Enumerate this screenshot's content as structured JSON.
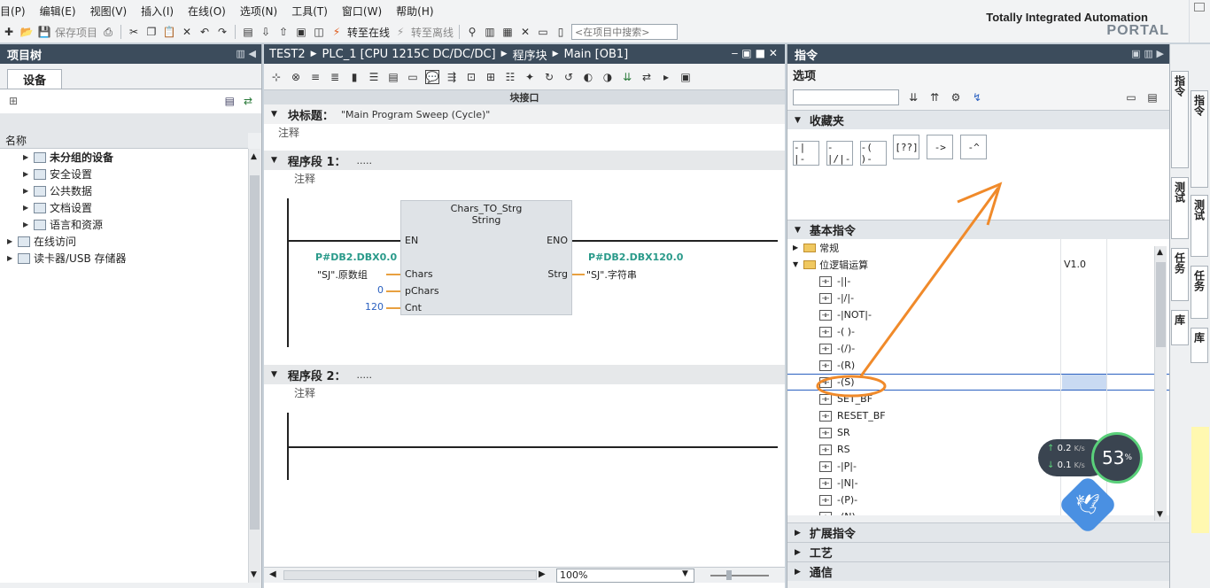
{
  "menu": [
    "目(P)",
    "编辑(E)",
    "视图(V)",
    "插入(I)",
    "在线(O)",
    "选项(N)",
    "工具(T)",
    "窗口(W)",
    "帮助(H)"
  ],
  "toolbar": {
    "save_project": "保存项目",
    "go_online": "转至在线",
    "go_offline": "转至离线",
    "search_placeholder": "<在项目中搜索>"
  },
  "brand": {
    "line1": "Totally Integrated Automation",
    "line2": "PORTAL"
  },
  "project_tree": {
    "title": "项目树",
    "tab": "设备",
    "column": "名称",
    "items": [
      {
        "label": "未分组的设备",
        "bold": true,
        "indent": 1
      },
      {
        "label": "安全设置",
        "indent": 1
      },
      {
        "label": "公共数据",
        "indent": 1
      },
      {
        "label": "文档设置",
        "indent": 1
      },
      {
        "label": "语言和资源",
        "indent": 1
      },
      {
        "label": "在线访问",
        "indent": 0
      },
      {
        "label": "读卡器/USB 存储器",
        "indent": 0
      }
    ]
  },
  "editor": {
    "breadcrumb": [
      "TEST2",
      "PLC_1 [CPU 1215C DC/DC/DC]",
      "程序块",
      "Main [OB1]"
    ],
    "interface_label": "块接口",
    "block_title_label": "块标题：",
    "block_title_value": "\"Main Program Sweep (Cycle)\"",
    "comment": "注释",
    "network1": {
      "label": "程序段 1：",
      "dots": "....."
    },
    "network2": {
      "label": "程序段 2：",
      "dots": "....."
    },
    "box": {
      "name": "Chars_TO_Strg",
      "type": "String",
      "en": "EN",
      "eno": "ENO",
      "in_pins": [
        "Chars",
        "pChars",
        "Cnt"
      ],
      "out_pin": "Strg",
      "chars_addr": "P#DB2.DBX0.0",
      "chars_tag": "\"SJ\".原数组",
      "pchars_val": "0",
      "cnt_val": "120",
      "strg_addr": "P#DB2.DBX120.0",
      "strg_tag": "\"SJ\".字符串"
    },
    "zoom": "100%"
  },
  "instructions": {
    "title": "指令",
    "options": "选项",
    "favorites": "收藏夹",
    "fav_items": [
      "-| |-",
      "-|/|-",
      "-( )-",
      "[??]",
      "->",
      "-^"
    ],
    "basic": "基本指令",
    "general": "常规",
    "bit_logic": "位逻辑运算",
    "version": "V1.0",
    "items": [
      "-||-",
      "-|/|-",
      "-|NOT|-",
      "-( )-",
      "-(/)-",
      "-(R)",
      "-(S)",
      "SET_BF",
      "RESET_BF",
      "SR",
      "RS",
      "-|P|-",
      "-|N|-",
      "-(P)-",
      "-(N)-"
    ],
    "selected_item": "-(S)",
    "extended": "扩展指令",
    "technology": "工艺",
    "communication": "通信"
  },
  "side_tabs": [
    "指令",
    "测试",
    "任务",
    "库"
  ],
  "net_widget": {
    "up": "0.2",
    "down": "0.1",
    "unit": "K/s",
    "percent": "53"
  },
  "colors": {
    "header": "#3c4c5c",
    "address": "#2a9a8a",
    "value": "#2a60c0",
    "highlight": "#c9daf2",
    "annot": "#f08a2a"
  }
}
